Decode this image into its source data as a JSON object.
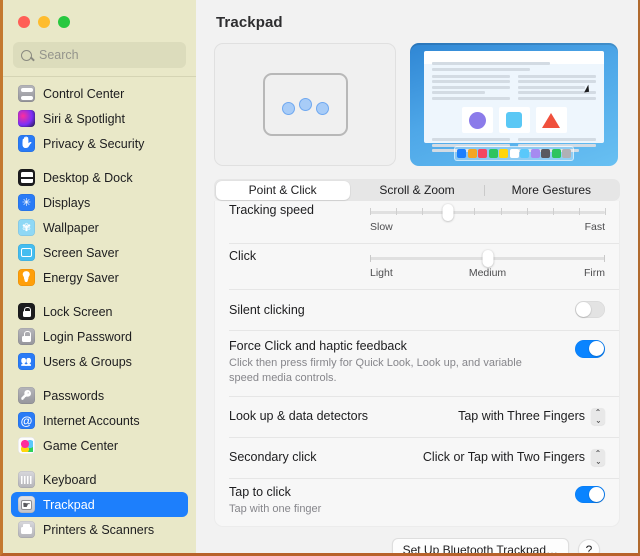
{
  "window": {
    "traffic_lights": [
      "close",
      "minimize",
      "zoom"
    ]
  },
  "sidebar": {
    "search": {
      "placeholder": "Search",
      "value": "",
      "icon": "search-icon"
    },
    "groups": [
      {
        "items": [
          {
            "label": "Control Center",
            "icon": "control-center-icon"
          },
          {
            "label": "Siri & Spotlight",
            "icon": "siri-icon"
          },
          {
            "label": "Privacy & Security",
            "icon": "privacy-hand-icon"
          }
        ]
      },
      {
        "items": [
          {
            "label": "Desktop & Dock",
            "icon": "desktop-dock-icon"
          },
          {
            "label": "Displays",
            "icon": "displays-icon"
          },
          {
            "label": "Wallpaper",
            "icon": "wallpaper-icon"
          },
          {
            "label": "Screen Saver",
            "icon": "screen-saver-icon"
          },
          {
            "label": "Energy Saver",
            "icon": "energy-saver-bulb-icon"
          }
        ]
      },
      {
        "items": [
          {
            "label": "Lock Screen",
            "icon": "lock-screen-icon"
          },
          {
            "label": "Login Password",
            "icon": "login-password-lock-icon"
          },
          {
            "label": "Users & Groups",
            "icon": "users-groups-icon"
          }
        ]
      },
      {
        "items": [
          {
            "label": "Passwords",
            "icon": "passwords-key-icon"
          },
          {
            "label": "Internet Accounts",
            "icon": "internet-accounts-at-icon"
          },
          {
            "label": "Game Center",
            "icon": "game-center-icon"
          }
        ]
      },
      {
        "items": [
          {
            "label": "Keyboard",
            "icon": "keyboard-icon"
          },
          {
            "label": "Trackpad",
            "icon": "trackpad-icon",
            "selected": true
          },
          {
            "label": "Printers & Scanners",
            "icon": "printer-icon"
          }
        ]
      }
    ],
    "selected_label": "Trackpad",
    "selection_color": "#1d7ffc"
  },
  "main": {
    "title": "Trackpad",
    "preview_left": {
      "name": "trackpad-three-finger-diagram",
      "finger_count": 3
    },
    "preview_right": {
      "name": "look-up-animation-preview",
      "swatches": [
        "#1d7ffc",
        "#f5a623",
        "#f4475f",
        "#2ec45f",
        "#ffd60a",
        "#ffffff",
        "#5ac8fa",
        "#a68bf0",
        "#5a5a5f",
        "#2ec45f",
        "#b0b0b5"
      ]
    },
    "tabs": [
      {
        "label": "Point & Click",
        "active": true
      },
      {
        "label": "Scroll & Zoom",
        "active": false
      },
      {
        "label": "More Gestures",
        "active": false
      }
    ],
    "settings": {
      "tracking_speed": {
        "label": "Tracking speed",
        "min_label": "Slow",
        "max_label": "Fast",
        "value_percent": 33,
        "tick_count": 10
      },
      "click": {
        "label": "Click",
        "min_label": "Light",
        "mid_label": "Medium",
        "max_label": "Firm",
        "value_percent": 50
      },
      "silent_clicking": {
        "label": "Silent clicking",
        "state": "off"
      },
      "force_click": {
        "label": "Force Click and haptic feedback",
        "description": "Click then press firmly for Quick Look, Look up, and variable speed media controls.",
        "state": "on"
      },
      "look_up": {
        "label": "Look up & data detectors",
        "value": "Tap with Three Fingers"
      },
      "secondary_click": {
        "label": "Secondary click",
        "value": "Click or Tap with Two Fingers"
      },
      "tap_to_click": {
        "label": "Tap to click",
        "description": "Tap with one finger",
        "state": "on"
      }
    },
    "footer": {
      "setup_button": "Set Up Bluetooth Trackpad…",
      "help_button": "?"
    }
  },
  "colors": {
    "accent_blue": "#0a84ff",
    "sidebar_bg": "#e9e8c8",
    "content_bg": "#f2f2f2"
  }
}
